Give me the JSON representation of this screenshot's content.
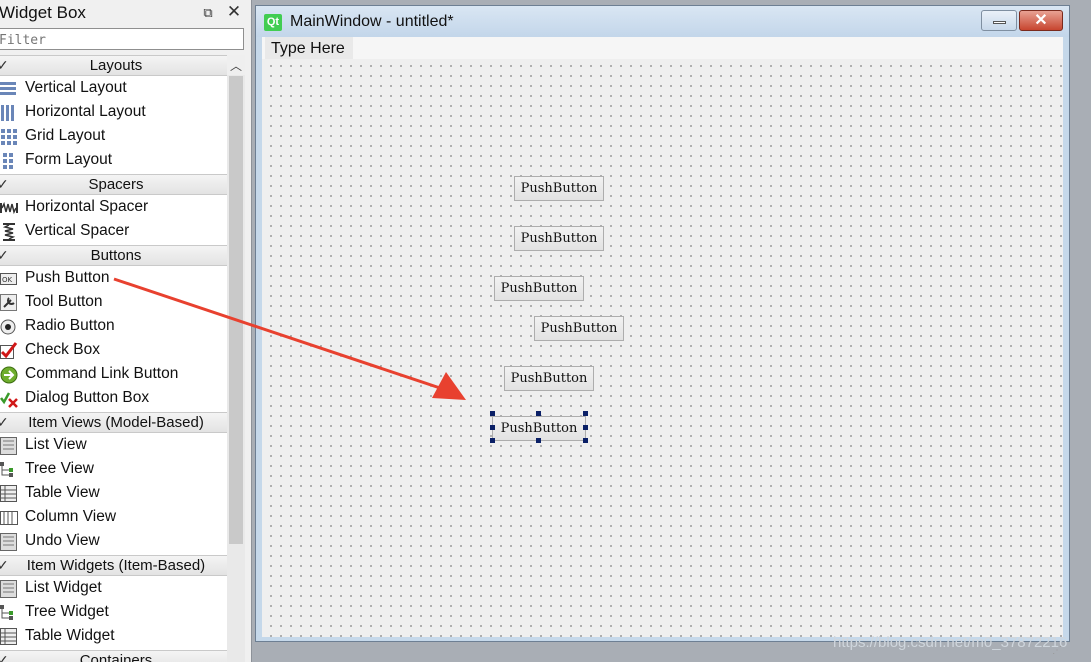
{
  "widget_box": {
    "title": "Widget Box",
    "float_icon": "float-icon",
    "close_label": "✕",
    "filter_placeholder": "Filter",
    "scroll_up": "︿",
    "categories": [
      {
        "label": "Layouts",
        "items": [
          {
            "label": "Vertical Layout",
            "icon": "vertical-layout-icon"
          },
          {
            "label": "Horizontal Layout",
            "icon": "horizontal-layout-icon"
          },
          {
            "label": "Grid Layout",
            "icon": "grid-layout-icon"
          },
          {
            "label": "Form Layout",
            "icon": "form-layout-icon"
          }
        ]
      },
      {
        "label": "Spacers",
        "items": [
          {
            "label": "Horizontal Spacer",
            "icon": "horizontal-spacer-icon"
          },
          {
            "label": "Vertical Spacer",
            "icon": "vertical-spacer-icon"
          }
        ]
      },
      {
        "label": "Buttons",
        "items": [
          {
            "label": "Push Button",
            "icon": "push-button-icon"
          },
          {
            "label": "Tool Button",
            "icon": "tool-button-icon"
          },
          {
            "label": "Radio Button",
            "icon": "radio-button-icon"
          },
          {
            "label": "Check Box",
            "icon": "check-box-icon"
          },
          {
            "label": "Command Link Button",
            "icon": "command-link-icon"
          },
          {
            "label": "Dialog Button Box",
            "icon": "dialog-button-box-icon"
          }
        ]
      },
      {
        "label": "Item Views (Model-Based)",
        "items": [
          {
            "label": "List View",
            "icon": "list-view-icon"
          },
          {
            "label": "Tree View",
            "icon": "tree-view-icon"
          },
          {
            "label": "Table View",
            "icon": "table-view-icon"
          },
          {
            "label": "Column View",
            "icon": "column-view-icon"
          },
          {
            "label": "Undo View",
            "icon": "undo-view-icon"
          }
        ]
      },
      {
        "label": "Item Widgets (Item-Based)",
        "items": [
          {
            "label": "List Widget",
            "icon": "list-widget-icon"
          },
          {
            "label": "Tree Widget",
            "icon": "tree-widget-icon"
          },
          {
            "label": "Table Widget",
            "icon": "table-widget-icon"
          }
        ]
      },
      {
        "label": "Containers",
        "items": []
      }
    ]
  },
  "main_window": {
    "title": "MainWindow - untitled*",
    "logo_text": "Qt",
    "close_label": "✕",
    "menu_placeholder": "Type Here",
    "buttons": [
      {
        "label": "PushButton",
        "selected": false
      },
      {
        "label": "PushButton",
        "selected": false
      },
      {
        "label": "PushButton",
        "selected": false
      },
      {
        "label": "PushButton",
        "selected": false
      },
      {
        "label": "PushButton",
        "selected": false
      },
      {
        "label": "PushButton",
        "selected": true
      }
    ]
  },
  "annotation": {
    "arrow_color": "#e8412f"
  },
  "watermark": "https://blog.csdn.net/m0_37872216"
}
